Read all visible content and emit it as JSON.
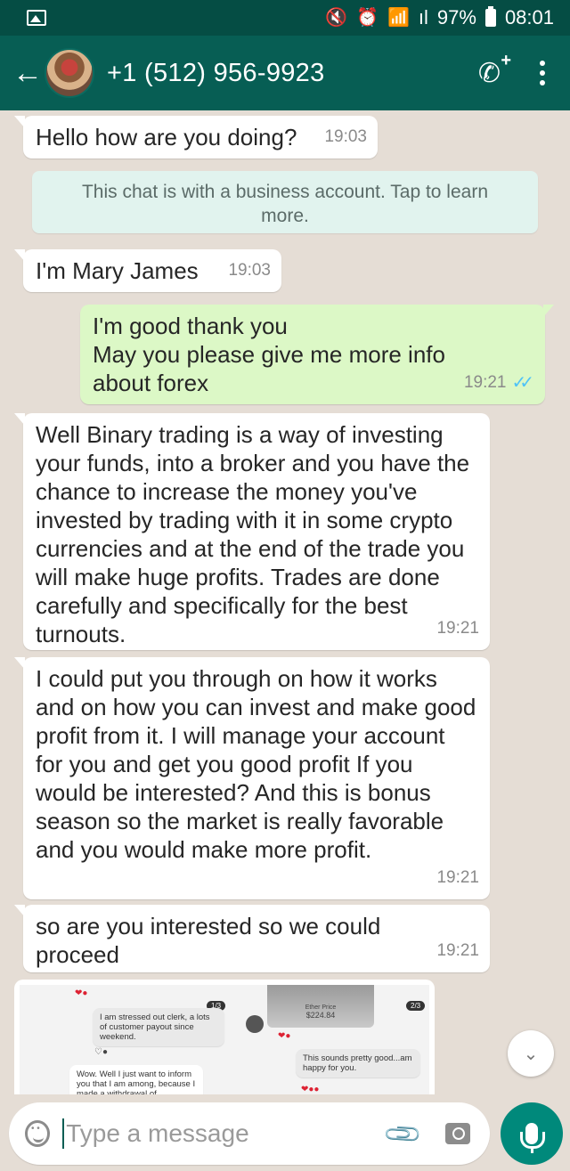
{
  "status_bar": {
    "signal": "ıl",
    "battery_percent": "97%",
    "time": "08:01"
  },
  "header": {
    "back_icon": "back-arrow-icon",
    "contact_name": "+1 (512) 956-9923",
    "call_icon": "add-call-icon",
    "menu_icon": "more-vert-icon"
  },
  "system_note": "This chat is with a business account. Tap to learn more.",
  "messages": [
    {
      "direction": "in",
      "text": "Hello how are you doing?",
      "time": "19:03"
    },
    {
      "direction": "in",
      "text": "I'm Mary James",
      "time": "19:03"
    },
    {
      "direction": "out",
      "text": "I'm good thank you\nMay you please give me more info about forex",
      "time": "19:21",
      "status": "read"
    },
    {
      "direction": "in",
      "text": "Well Binary trading is a way of investing your funds, into a broker and you have the chance to increase the money you've invested by trading with it in some crypto currencies and at the end of the trade you will make huge profits. Trades are done carefully and specifically for the best turnouts.",
      "time": "19:21"
    },
    {
      "direction": "in",
      "text": "I could  put you through on how it works and on how you can invest and make good profit from it. I will manage your account for you and get you good profit If you would be interested? And this is bonus season so the market is really favorable and you would make more profit.",
      "time": "19:21"
    },
    {
      "direction": "in",
      "text": "so are you interested so we could proceed",
      "time": "19:21"
    }
  ],
  "image_message": {
    "badge_1": "1/3",
    "text_1": "I am stressed out clerk, a lots of customer payout since weekend.",
    "text_2": "Wow. Well I just want to inform you that I am among, because I made a withdrawal of",
    "badge_2": "2/3",
    "photo_label": "Ether Price",
    "photo_amount": "$224.84",
    "text_3": "This sounds pretty good...am happy for you."
  },
  "input": {
    "placeholder": "Type a message"
  },
  "colors": {
    "header": "#075e54",
    "status_bar": "#054d44",
    "outgoing_bubble": "#dcf8c6",
    "chat_background": "#e5ddd5",
    "mic_button": "#00897b",
    "read_ticks": "#4fc3f7"
  }
}
